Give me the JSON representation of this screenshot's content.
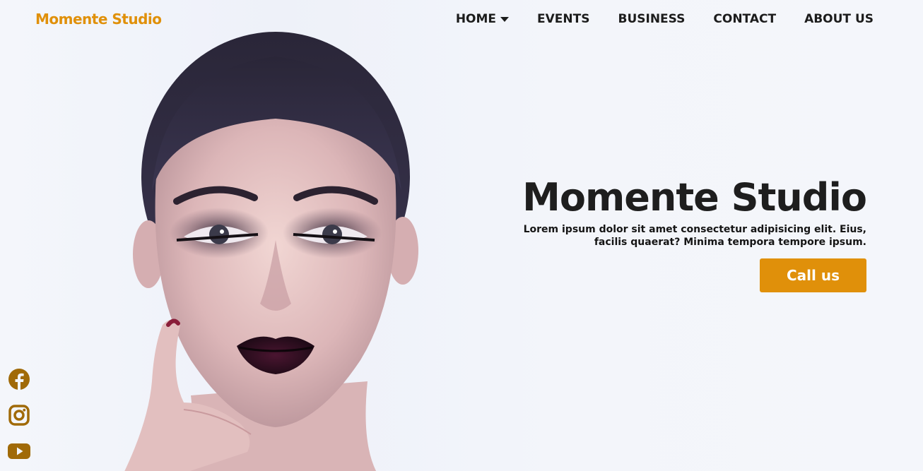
{
  "header": {
    "brand": "Momente Studio",
    "nav": [
      {
        "label": "HOME",
        "icon": "caret-down-icon"
      },
      {
        "label": "EVENTS"
      },
      {
        "label": "BUSINESS"
      },
      {
        "label": "CONTACT"
      },
      {
        "label": "ABOUT US"
      }
    ]
  },
  "hero": {
    "title": "Momente Studio",
    "description": "Lorem ipsum dolor sit amet consectetur adipisicing elit. Eius, facilis quaerat? Minima tempora tempore ipsum.",
    "cta_label": "Call us"
  },
  "socials": [
    {
      "icon": "facebook-icon"
    },
    {
      "icon": "instagram-icon"
    },
    {
      "icon": "youtube-icon"
    }
  ],
  "colors": {
    "accent": "#e0900a",
    "social_icon": "#a06a08",
    "text_dark": "#1e1e1e",
    "background": "#f3f5fa"
  }
}
